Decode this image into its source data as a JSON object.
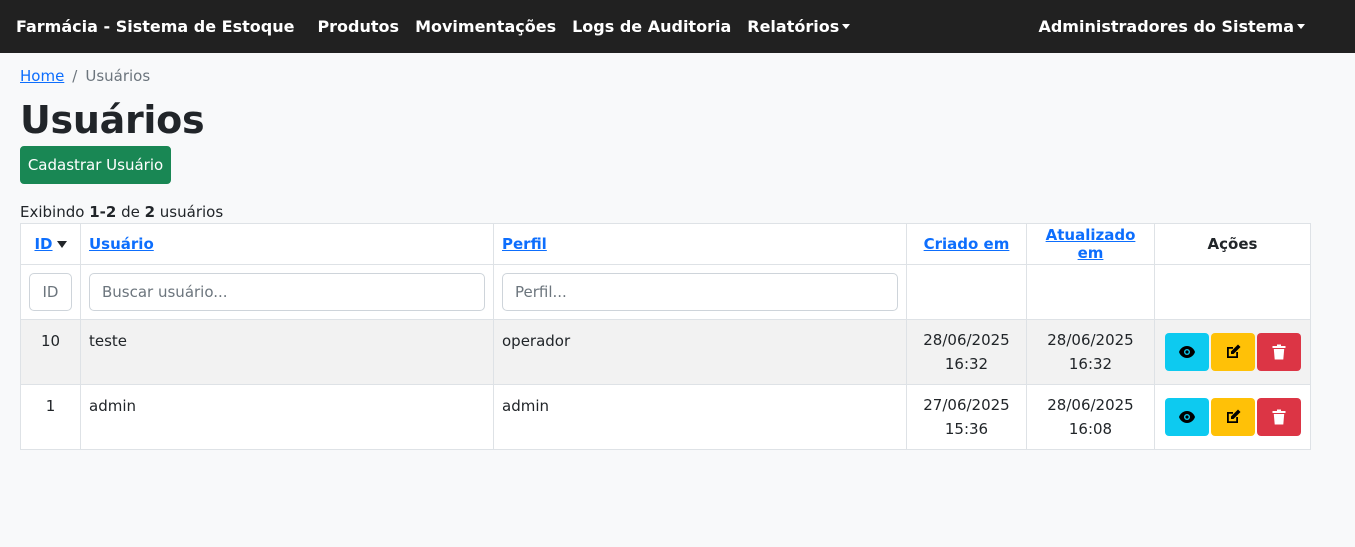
{
  "navbar": {
    "brand": "Farmácia - Sistema de Estoque",
    "items": [
      {
        "label": "Produtos"
      },
      {
        "label": "Movimentações"
      },
      {
        "label": "Logs de Auditoria"
      },
      {
        "label": "Relatórios"
      }
    ],
    "user_menu": "Administradores do Sistema"
  },
  "breadcrumb": {
    "home": "Home",
    "separator": "/",
    "current": "Usuários"
  },
  "page": {
    "title": "Usuários",
    "add_button": "Cadastrar Usuário"
  },
  "count": {
    "prefix": "Exibindo ",
    "range": "1-2",
    "mid": " de ",
    "total": "2",
    "suffix": " usuários"
  },
  "table": {
    "headers": {
      "id": "ID",
      "user": "Usuário",
      "profile": "Perfil",
      "created": "Criado em",
      "updated": "Atualizado em",
      "actions": "Ações"
    },
    "filters": {
      "id_placeholder": "ID",
      "user_placeholder": "Buscar usuário...",
      "profile_placeholder": "Perfil..."
    },
    "rows": [
      {
        "id": "10",
        "user": "teste",
        "profile": "operador",
        "created_date": "28/06/2025",
        "created_time": "16:32",
        "updated_date": "28/06/2025",
        "updated_time": "16:32"
      },
      {
        "id": "1",
        "user": "admin",
        "profile": "admin",
        "created_date": "27/06/2025",
        "created_time": "15:36",
        "updated_date": "28/06/2025",
        "updated_time": "16:08"
      }
    ]
  },
  "colors": {
    "navbar": "#212121",
    "success": "#198754",
    "info": "#0dcaf0",
    "warning": "#ffc107",
    "danger": "#dc3545",
    "link": "#0d6efd"
  },
  "icons": {
    "view": "eye-icon",
    "edit": "edit-icon",
    "delete": "trash-icon"
  }
}
